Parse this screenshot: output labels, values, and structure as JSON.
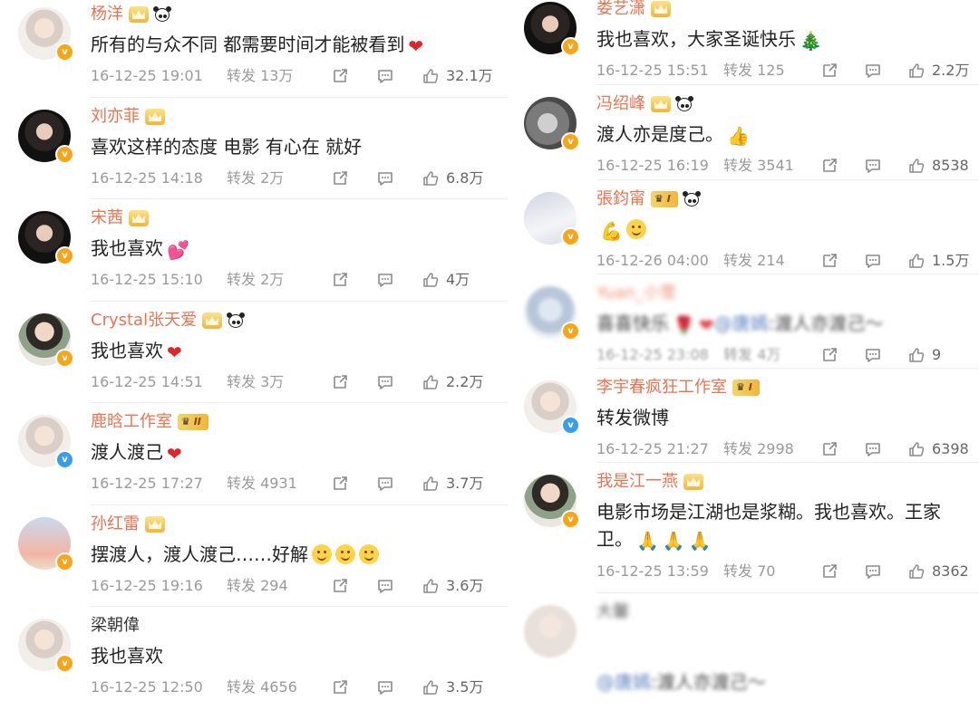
{
  "actions": {
    "repost_label": "转发"
  },
  "left": [
    {
      "name": "杨洋",
      "name_style": "orange",
      "badges": [
        "crown",
        "panda"
      ],
      "vbadge": "orange",
      "face": "light",
      "text": "所有的与众不同 都需要时间才能被看到",
      "emojis": [
        "heart"
      ],
      "time": "16-12-25 19:01",
      "repost": "转发 13万",
      "likes": "32.1万"
    },
    {
      "name": "刘亦菲",
      "name_style": "orange",
      "badges": [
        "crown"
      ],
      "vbadge": "orange",
      "face": "dark",
      "text": "喜欢这样的态度 电影 有心在 就好",
      "emojis": [],
      "time": "16-12-25 14:18",
      "repost": "转发 2万",
      "likes": "6.8万"
    },
    {
      "name": "宋茜",
      "name_style": "orange",
      "badges": [
        "crown"
      ],
      "vbadge": "orange",
      "face": "dark",
      "text": "我也喜欢",
      "emojis": [
        "pinkheart"
      ],
      "time": "16-12-25 15:10",
      "repost": "转发 2万",
      "likes": "4万"
    },
    {
      "name": "Crystal张天爱",
      "name_style": "orange",
      "badges": [
        "crown",
        "panda"
      ],
      "vbadge": "orange",
      "face": "green",
      "text": "我也喜欢",
      "emojis": [
        "heart"
      ],
      "time": "16-12-25 14:51",
      "repost": "转发 3万",
      "likes": "2.2万"
    },
    {
      "name": "鹿晗工作室",
      "name_style": "orange",
      "badges": [
        "vip2"
      ],
      "vbadge": "blue",
      "face": "light",
      "text": "渡人渡己",
      "emojis": [
        "heart"
      ],
      "time": "16-12-25 17:27",
      "repost": "转发 4931",
      "likes": "3.7万"
    },
    {
      "name": "孙红雷",
      "name_style": "orange",
      "badges": [
        "crown"
      ],
      "vbadge": "orange",
      "face": "sky",
      "text": "摆渡人，渡人渡己……好解",
      "emojis": [
        "smile",
        "smile",
        "smile"
      ],
      "time": "16-12-25 19:16",
      "repost": "转发 294",
      "likes": "3.6万"
    },
    {
      "name": "梁朝偉",
      "name_style": "plain",
      "badges": [],
      "vbadge": "orange",
      "face": "light",
      "text": "我也喜欢",
      "emojis": [],
      "time": "16-12-25 12:50",
      "repost": "转发 4656",
      "likes": "3.5万"
    }
  ],
  "right": [
    {
      "name": "娄艺潇",
      "name_style": "orange",
      "badges": [
        "crown"
      ],
      "vbadge": "orange",
      "face": "dark",
      "text": "我也喜欢，大家圣诞快乐",
      "emojis": [
        "tree"
      ],
      "time": "16-12-25 15:51",
      "repost": "转发 125",
      "likes": "2.2万"
    },
    {
      "name": "冯绍峰",
      "name_style": "orange",
      "badges": [
        "crown",
        "panda"
      ],
      "vbadge": "orange",
      "face": "gray",
      "text": "渡人亦是度己。",
      "emojis": [
        "thumb"
      ],
      "time": "16-12-25 16:19",
      "repost": "转发 3541",
      "likes": "8538"
    },
    {
      "name": "張鈞甯",
      "name_style": "orange",
      "badges": [
        "vip1",
        "panda"
      ],
      "vbadge": "orange",
      "face": "night",
      "text": "",
      "emojis": [
        "arm",
        "smile"
      ],
      "time": "16-12-26 04:00",
      "repost": "转发 214",
      "likes": "1.5万"
    },
    {
      "name": "Yuan_小雪",
      "name_style": "orange",
      "blurred": true,
      "badges": [],
      "vbadge": "orange",
      "face": "blurry",
      "text": "喜喜快乐",
      "mention": "@唐嫣",
      "tail": ":渡人亦渡己～",
      "emojis": [
        "rose",
        "heart"
      ],
      "time": "16-12-25 23:08",
      "repost": "转发 4万",
      "likes": "9"
    },
    {
      "name": "李宇春疯狂工作室",
      "name_style": "orange",
      "badges": [
        "vip1"
      ],
      "vbadge": "blue",
      "face": "light",
      "text": "转发微博",
      "emojis": [],
      "time": "16-12-25 21:27",
      "repost": "转发 2998",
      "likes": "6398"
    },
    {
      "name": "我是江一燕",
      "name_style": "orange",
      "badges": [
        "crown"
      ],
      "vbadge": "orange",
      "face": "green",
      "text": "电影市场是江湖也是浆糊。我也喜欢。王家卫。",
      "emojis": [
        "pray",
        "pray",
        "pray"
      ],
      "time": "16-12-25 13:59",
      "repost": "转发 70",
      "likes": "8362"
    },
    {
      "name": "大馨",
      "name_style": "plain",
      "blurred": true,
      "badges": [],
      "vbadge": "",
      "face": "pale",
      "text": "",
      "mention": "@唐嫣",
      "tail": ":渡人亦渡己～",
      "emojis": [],
      "time": "",
      "repost": "",
      "likes": ""
    }
  ]
}
